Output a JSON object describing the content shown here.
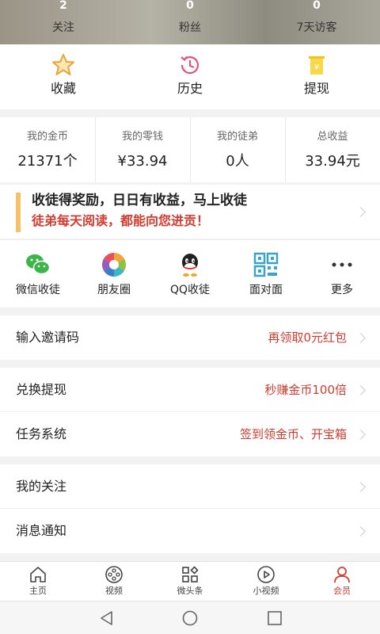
{
  "header": {
    "stats": [
      {
        "value": "2",
        "label": "关注"
      },
      {
        "value": "0",
        "label": "粉丝"
      },
      {
        "value": "0",
        "label": "7天访客"
      }
    ]
  },
  "quick_actions": [
    {
      "label": "收藏",
      "icon": "star-icon"
    },
    {
      "label": "历史",
      "icon": "clock-icon"
    },
    {
      "label": "提现",
      "icon": "withdraw-icon"
    }
  ],
  "wallet": [
    {
      "label": "我的金币",
      "value": "21371个"
    },
    {
      "label": "我的零钱",
      "value": "¥33.94"
    },
    {
      "label": "我的徒弟",
      "value": "0人"
    },
    {
      "label": "总收益",
      "value": "33.94元"
    }
  ],
  "promo": {
    "line1": "收徒得奖励，日日有收益，马上收徒",
    "line2": "徒弟每天阅读，都能向您进贡！"
  },
  "share": [
    {
      "label": "微信收徒",
      "icon": "wechat-icon"
    },
    {
      "label": "朋友圈",
      "icon": "moments-icon"
    },
    {
      "label": "QQ收徒",
      "icon": "qq-icon"
    },
    {
      "label": "面对面",
      "icon": "qrcode-icon"
    },
    {
      "label": "更多",
      "icon": "more-icon"
    }
  ],
  "rows": {
    "invite": {
      "label": "输入邀请码",
      "value": "再领取0元红包"
    },
    "exchange": {
      "label": "兑换提现",
      "value": "秒赚金币100倍"
    },
    "tasks": {
      "label": "任务系统",
      "value": "签到领金币、开宝箱"
    },
    "following": {
      "label": "我的关注",
      "value": ""
    },
    "notifications": {
      "label": "消息通知",
      "value": ""
    }
  },
  "tabs": [
    {
      "label": "主页",
      "icon": "home-icon"
    },
    {
      "label": "视频",
      "icon": "film-icon"
    },
    {
      "label": "微头条",
      "icon": "grid-icon"
    },
    {
      "label": "小视频",
      "icon": "play-icon"
    },
    {
      "label": "会员",
      "icon": "user-icon",
      "active": true
    }
  ],
  "colors": {
    "accent_red": "#d43b2f",
    "promo_bar": "#f4c26b"
  }
}
